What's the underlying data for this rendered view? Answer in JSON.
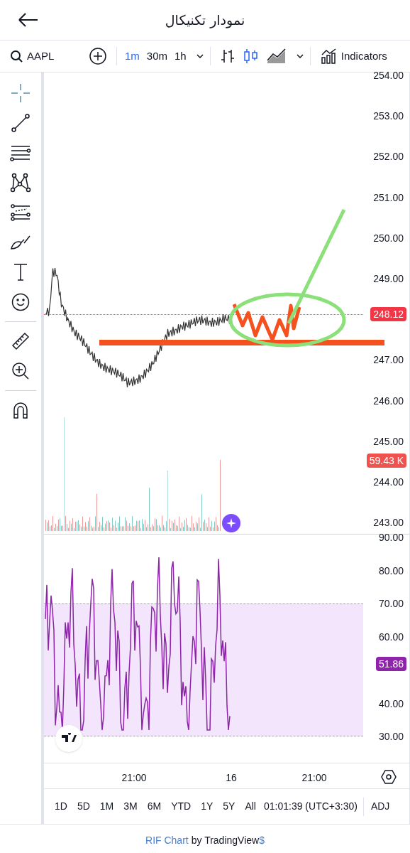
{
  "header": {
    "title": "نمودار تکنیکال"
  },
  "toolbar": {
    "symbol": "AAPL",
    "intervals": [
      {
        "label": "1m",
        "selected": true
      },
      {
        "label": "30m",
        "selected": false
      },
      {
        "label": "1h",
        "selected": false
      }
    ],
    "chart_types": [
      {
        "kind": "bars",
        "selected": false
      },
      {
        "kind": "candles",
        "selected": true
      },
      {
        "kind": "area",
        "selected": false
      }
    ],
    "indicators": "Indicators"
  },
  "tool_groups": [
    [
      {
        "kind": "crosshair",
        "selected": true
      },
      {
        "kind": "trend-line",
        "selected": false
      },
      {
        "kind": "fib",
        "selected": false
      },
      {
        "kind": "pattern",
        "selected": false
      },
      {
        "kind": "projection",
        "selected": false
      },
      {
        "kind": "brush",
        "selected": false
      },
      {
        "kind": "text",
        "selected": false
      },
      {
        "kind": "emoji",
        "selected": false
      }
    ],
    [
      {
        "kind": "ruler",
        "selected": false
      },
      {
        "kind": "zoom",
        "selected": false
      }
    ],
    [
      {
        "kind": "magnet",
        "selected": false
      }
    ]
  ],
  "price_axis_upper": [
    "254.00",
    "253.00",
    "252.00",
    "251.00",
    "250.00",
    "249.00"
  ],
  "price_axis_lower": [
    "247.00",
    "246.00",
    "245.00",
    "244.00",
    "243.00"
  ],
  "last_price": "248.12",
  "volume_badge": "59.43 K",
  "rsi_axis_upper": [
    "90.00",
    "80.00",
    "70.00",
    "60.00"
  ],
  "rsi_axis_lower": [
    "40.00",
    "30.00"
  ],
  "rsi_badge": "51.86",
  "time_axis": [
    "21:00",
    "16",
    "21:00"
  ],
  "ranges": [
    "1D",
    "5D",
    "1M",
    "3M",
    "6M",
    "YTD",
    "1Y",
    "5Y",
    "All"
  ],
  "clock": "01:01:39 (UTC+3:30)",
  "adj": "ADJ",
  "footer": {
    "link": "RIF Chart",
    "text": "by TradingView",
    "mark": "$"
  }
}
